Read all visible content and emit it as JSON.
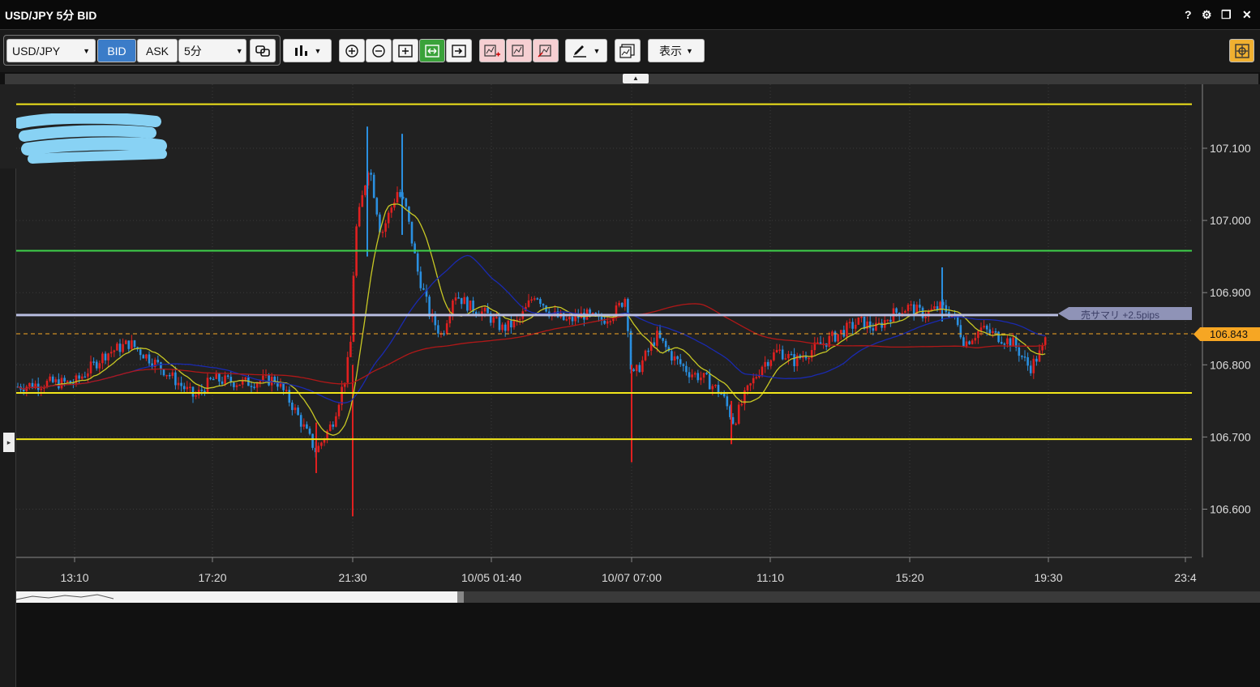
{
  "window": {
    "title": "USD/JPY 5分 BID",
    "controls": [
      "?",
      "⚙",
      "❐",
      "✕"
    ]
  },
  "toolbar": {
    "symbol": "USD/JPY",
    "bid_label": "BID",
    "ask_label": "ASK",
    "timeframe": "5分",
    "display_label": "表示"
  },
  "chart": {
    "y_ticks": [
      "107.100",
      "107.000",
      "106.900",
      "106.800",
      "106.700",
      "106.600"
    ],
    "x_ticks": [
      "13:10",
      "17:20",
      "21:30",
      "10/05 01:40",
      "10/07 07:00",
      "11:10",
      "15:20",
      "19:30",
      "23:4"
    ],
    "current_price": "106.843",
    "position_label": "売サマリ +2.5pips",
    "colors": {
      "background": "#212121",
      "up_candle": "#e02020",
      "down_candle": "#2a8fe0",
      "yellow_line": "#f2e61a",
      "green_line": "#3ed24a",
      "position_line": "#b8bde0",
      "price_tag": "#f6a623"
    }
  }
}
